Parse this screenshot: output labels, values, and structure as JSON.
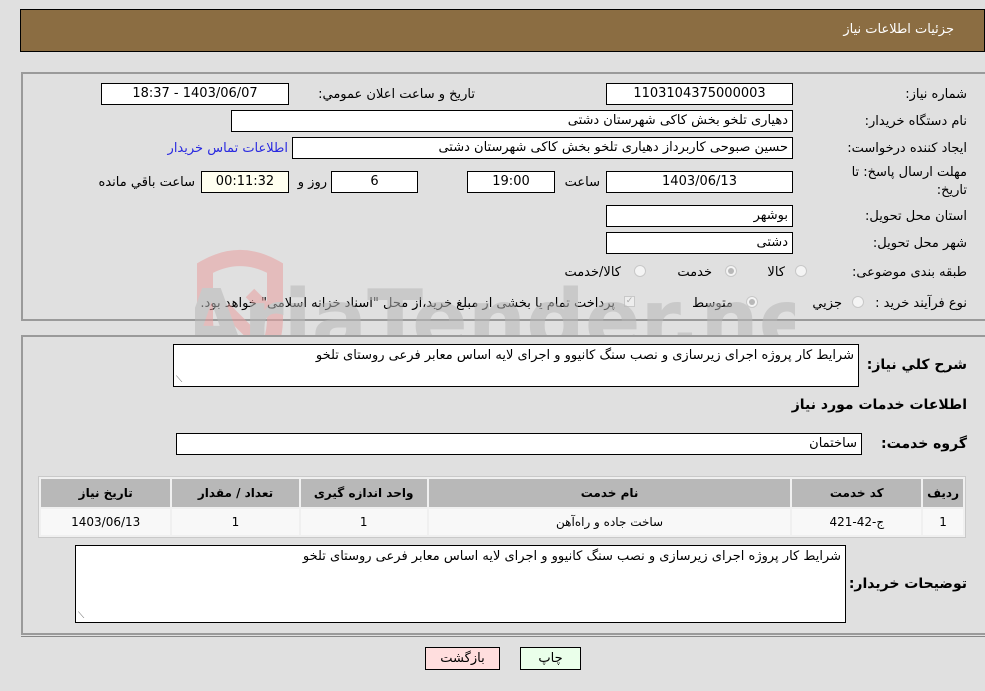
{
  "header": {
    "title": "جزئیات اطلاعات نیاز"
  },
  "fields": {
    "need_number": {
      "label": "شماره نیاز:",
      "value": "1103104375000003"
    },
    "announce_datetime": {
      "label": "تاریخ و ساعت اعلان عمومي:",
      "value": "1403/06/07 - 18:37"
    },
    "buyer_org": {
      "label": "نام دستگاه خریدار:",
      "value": "دهیاری تلخو بخش کاکی شهرستان دشتی"
    },
    "requester": {
      "label": "ایجاد کننده درخواست:",
      "value": "حسین صبوحی کاربرداز دهیاری تلخو بخش کاکی شهرستان دشتی"
    },
    "contact_link": "اطلاعات تماس خریدار",
    "deadline": {
      "label_line1": "مهلت ارسال پاسخ: تا",
      "label_line2": "تاریخ:",
      "date": "1403/06/13",
      "time_label": "ساعت",
      "time": "19:00",
      "days": "6",
      "days_label": "روز و",
      "remaining": "00:11:32",
      "remaining_label": "ساعت باقي مانده"
    },
    "province": {
      "label": "استان محل تحویل:",
      "value": "بوشهر"
    },
    "city": {
      "label": "شهر محل تحویل:",
      "value": "دشتی"
    },
    "category": {
      "label": "طبقه بندی موضوعی:",
      "options": [
        "کالا",
        "خدمت",
        "کالا/خدمت"
      ],
      "selected": "خدمت"
    },
    "purchase_type": {
      "label": "نوع فرآیند خرید :",
      "options": [
        "جزیي",
        "متوسط"
      ],
      "selected": "متوسط",
      "treasury_note": "پرداخت تمام یا بخشی از مبلغ خرید،از محل \"اسناد خزانه اسلامی\" خواهد بود."
    }
  },
  "description": {
    "label": "شرح کلي نياز:",
    "value": "شرایط کار پروژه اجرای زیرسازی و نصب سنگ کانیوو و اجرای لایه اساس معابر فرعی روستای تلخو"
  },
  "services_section": {
    "title": "اطلاعات خدمات مورد نیاز",
    "group_label": "گروه خدمت:",
    "group_value": "ساختمان",
    "table": {
      "headers": [
        "ردیف",
        "کد خدمت",
        "نام خدمت",
        "واحد اندازه گیری",
        "تعداد / مقدار",
        "تاریخ نیاز"
      ],
      "rows": [
        [
          "1",
          "ج-42-421",
          "ساخت جاده و راه‌آهن",
          "1",
          "1",
          "1403/06/13"
        ]
      ]
    }
  },
  "buyer_notes": {
    "label": "توضیحات خریدار:",
    "value": "شرایط کار پروژه اجرای زیرسازی و نصب سنگ کانیوو و اجرای لایه اساس معابر فرعی روستای تلخو"
  },
  "buttons": {
    "print": "چاپ",
    "back": "بازگشت"
  },
  "watermark": {
    "text": "AriaTender.neT"
  }
}
